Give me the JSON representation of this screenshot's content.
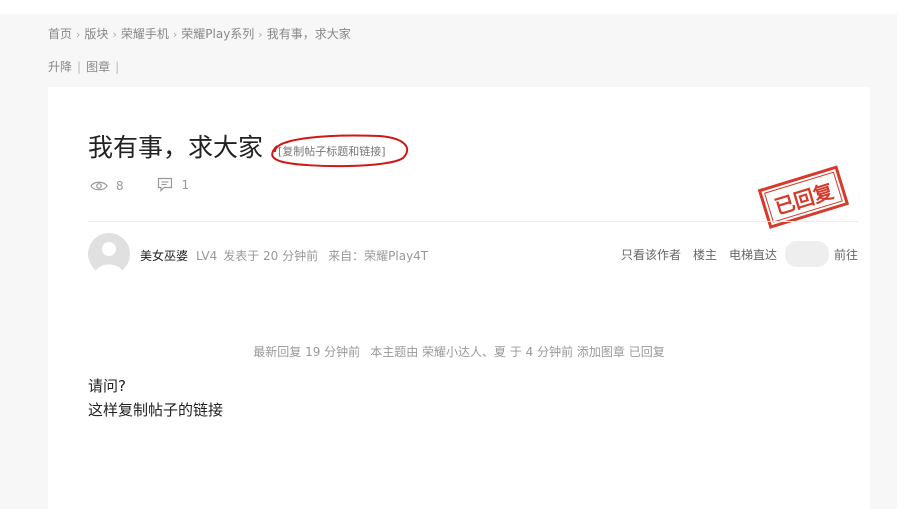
{
  "breadcrumb": {
    "items": [
      "首页",
      "版块",
      "荣耀手机",
      "荣耀Play系列",
      "我有事，求大家"
    ],
    "separator": "›"
  },
  "post_ops": {
    "items": [
      "升降",
      "图章"
    ],
    "separator": "|"
  },
  "post": {
    "title": "我有事，求大家",
    "copy_link_label": "[复制帖子标题和链接]",
    "views": "8",
    "replies": "1",
    "stamp_text": "已回复"
  },
  "author": {
    "name": "美女巫婆",
    "level": "LV4",
    "posted_at": "发表于 20 分钟前",
    "source": "来自：荣耀Play4T"
  },
  "tools": {
    "only_author": "只看该作者",
    "op": "楼主",
    "jump": "电梯直达",
    "go": "前往"
  },
  "notice": {
    "latest_reply": "最新回复 19 分钟前",
    "stamp_info": "本主题由 荣耀小达人、夏 于 4 分钟前 添加图章 已回复"
  },
  "body": {
    "lines": [
      "请问?",
      "这样复制帖子的链接"
    ]
  },
  "colors": {
    "stamp_red": "#d53a2b",
    "annotation_red": "#d01818"
  }
}
